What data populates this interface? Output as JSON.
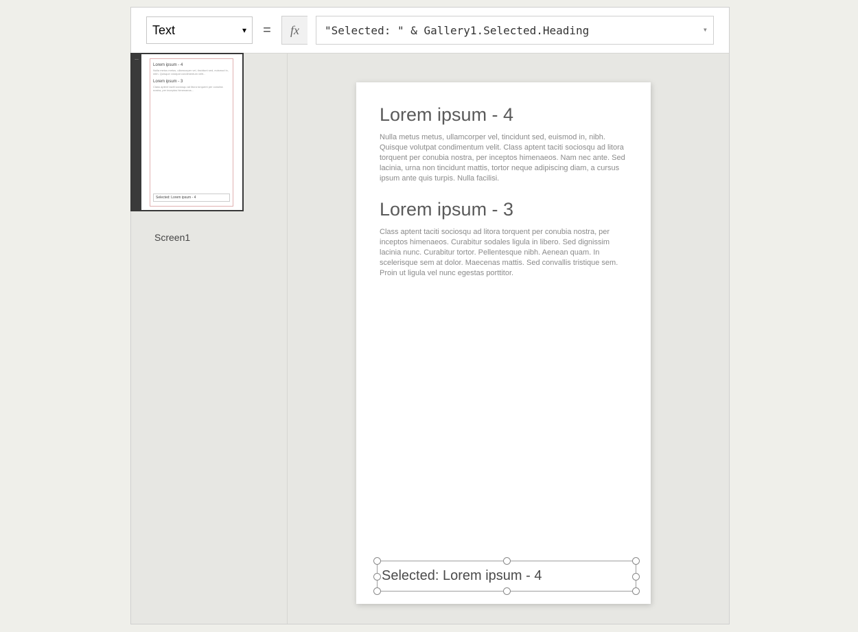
{
  "formulaBar": {
    "property": "Text",
    "fx": "fx",
    "formula": "\"Selected: \" & Gallery1.Selected.Heading"
  },
  "tree": {
    "screenLabel": "Screen1",
    "thumb": {
      "h1": "Lorem ipsum - 4",
      "p1": "Nulla metus metus, ullamcorper vel, tincidunt sed, euismod in, nibh. Quisque volutpat condimentum velit...",
      "h2": "Lorem ipsum - 3",
      "p2": "Class aptent taciti sociosqu ad litora torquent per conubia nostra, per inceptos himenaeos...",
      "selected": "Selected: Lorem ipsum - 4",
      "dots": "..."
    }
  },
  "canvas": {
    "items": [
      {
        "heading": "Lorem ipsum - 4",
        "body": "Nulla metus metus, ullamcorper vel, tincidunt sed, euismod in, nibh. Quisque volutpat condimentum velit. Class aptent taciti sociosqu ad litora torquent per conubia nostra, per inceptos himenaeos. Nam nec ante. Sed lacinia, urna non tincidunt mattis, tortor neque adipiscing diam, a cursus ipsum ante quis turpis. Nulla facilisi."
      },
      {
        "heading": "Lorem ipsum - 3",
        "body": "Class aptent taciti sociosqu ad litora torquent per conubia nostra, per inceptos himenaeos. Curabitur sodales ligula in libero. Sed dignissim lacinia nunc. Curabitur tortor. Pellentesque nibh. Aenean quam. In scelerisque sem at dolor. Maecenas mattis. Sed convallis tristique sem. Proin ut ligula vel nunc egestas porttitor."
      }
    ],
    "selectedLabel": "Selected: Lorem ipsum - 4"
  }
}
